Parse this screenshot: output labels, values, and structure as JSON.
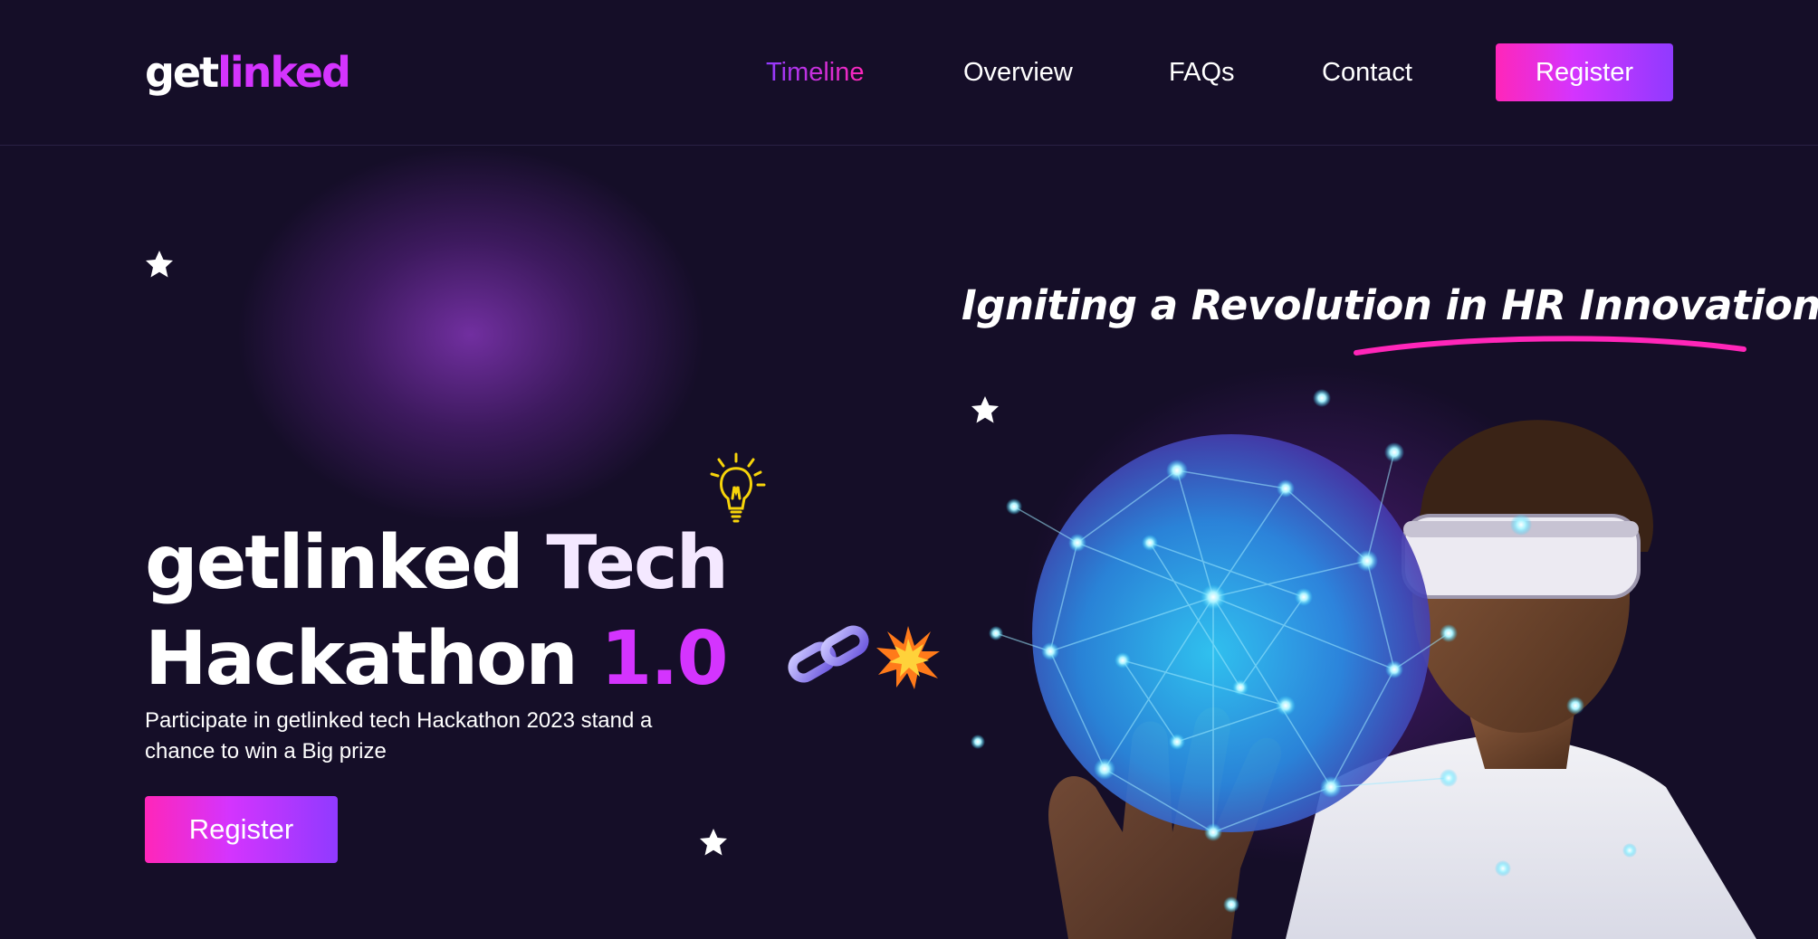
{
  "brand": {
    "logo_part1": "get",
    "logo_part2": "linked",
    "accent": "#d434fe",
    "pink": "#ff26b9",
    "purple": "#903aff",
    "background": "#150e28"
  },
  "nav": {
    "items": [
      {
        "label": "Timeline",
        "active": true
      },
      {
        "label": "Overview",
        "active": false
      },
      {
        "label": "FAQs",
        "active": false
      },
      {
        "label": "Contact",
        "active": false
      }
    ],
    "register_label": "Register"
  },
  "hero": {
    "title_word1": "getlinked",
    "title_word2": "Tech",
    "title_word3": "Hackathon",
    "title_version": "1.0",
    "subtitle": "Participate in getlinked tech Hackathon 2023 stand a chance to win a Big prize",
    "register_label": "Register",
    "icons": [
      "star-icon",
      "lightbulb-icon",
      "chain-link-icon",
      "explosion-icon"
    ]
  },
  "tagline": {
    "text": "Igniting a Revolution in HR Innovation"
  },
  "illustration": {
    "subject": "man-with-vr-headset-network-globe-image"
  }
}
